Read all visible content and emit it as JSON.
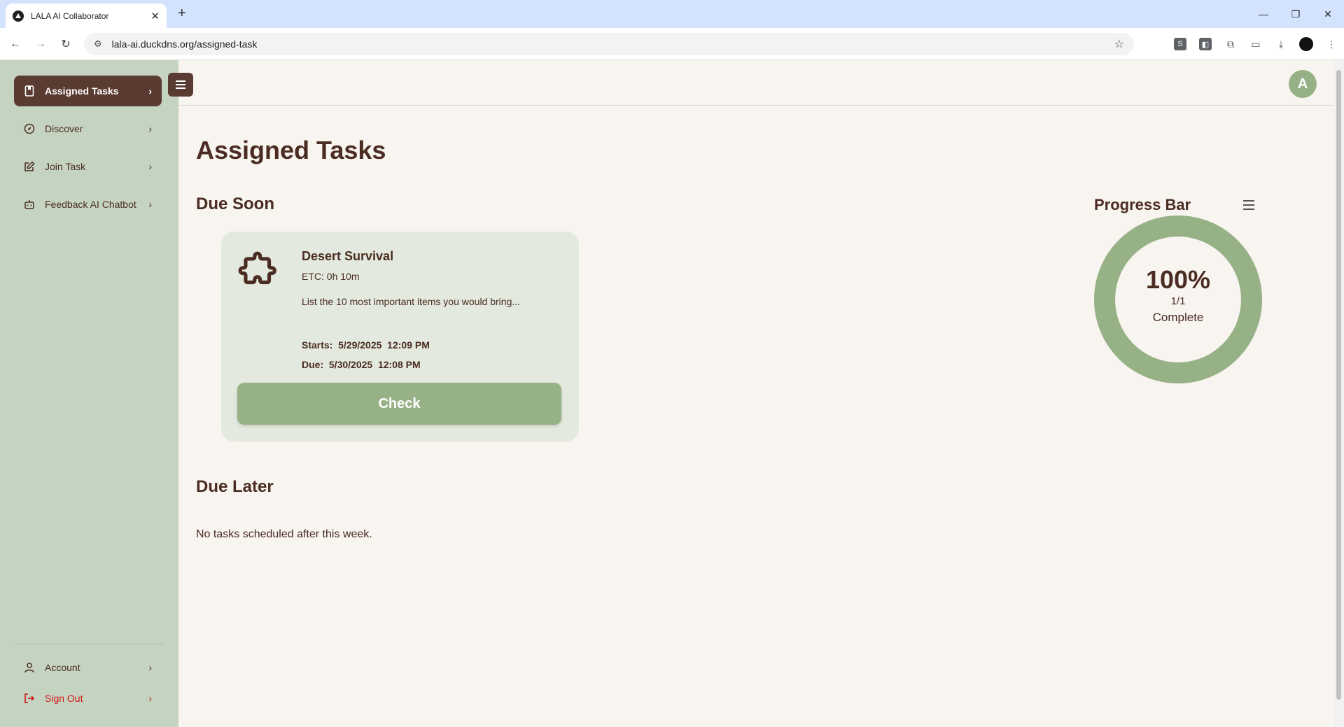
{
  "browser": {
    "tab_title": "LALA AI Collaborator",
    "url": "lala-ai.duckdns.org/assigned-task"
  },
  "sidebar": {
    "items": [
      {
        "label": "Assigned Tasks",
        "icon": "book-icon"
      },
      {
        "label": "Discover",
        "icon": "compass-icon"
      },
      {
        "label": "Join Task",
        "icon": "edit-icon"
      },
      {
        "label": "Feedback AI Chatbot",
        "icon": "bot-icon"
      }
    ],
    "account_label": "Account",
    "signout_label": "Sign Out"
  },
  "header": {
    "avatar_initial": "A"
  },
  "main": {
    "page_title": "Assigned Tasks",
    "due_soon_title": "Due Soon",
    "due_later_title": "Due Later",
    "due_later_empty": "No tasks scheduled after this week.",
    "task": {
      "name": "Desert Survival",
      "etc": "ETC: 0h 10m",
      "description": "List the 10 most important items you would bring...",
      "starts": "Starts:  5/29/2025  12:09 PM",
      "due": "Due:  5/30/2025  12:08 PM",
      "button_label": "Check"
    }
  },
  "progress": {
    "title": "Progress Bar",
    "percent_text": "100%",
    "count_text": "1/1",
    "status_text": "Complete",
    "fraction": 1.0,
    "color": "#97b187"
  },
  "colors": {
    "sidebar_bg": "#c5d4c0",
    "accent_dark": "#5a3b32",
    "accent_green": "#97b187",
    "page_bg": "#f8f4ef",
    "text": "#4a2c22",
    "signout": "#d01616"
  }
}
